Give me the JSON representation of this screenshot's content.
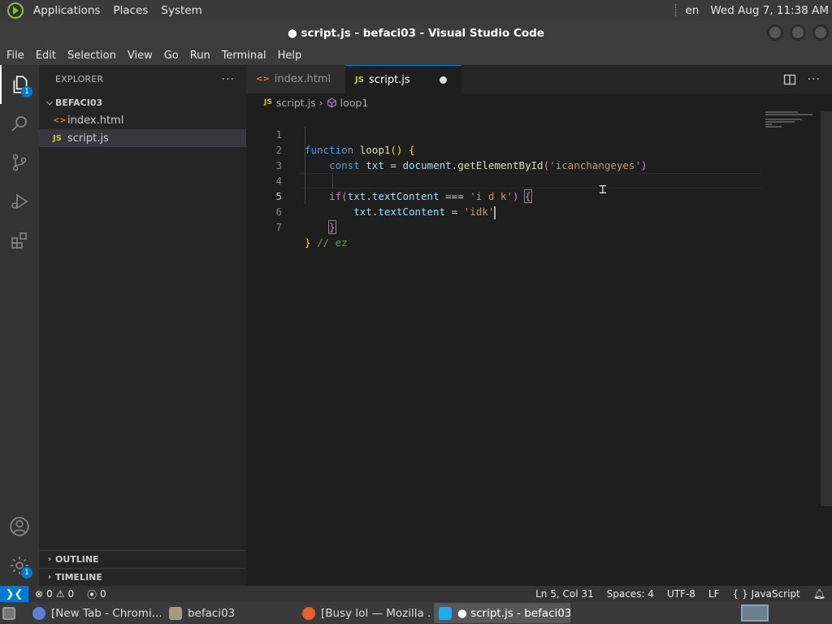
{
  "system_panel": {
    "menu": [
      "Applications",
      "Places",
      "System"
    ],
    "language": "en",
    "clock": "Wed Aug  7, 11:38 AM"
  },
  "window": {
    "title": "● script.js - befaci03 - Visual Studio Code"
  },
  "menubar": [
    "File",
    "Edit",
    "Selection",
    "View",
    "Go",
    "Run",
    "Terminal",
    "Help"
  ],
  "activity_bar": {
    "items": [
      {
        "icon": "files-icon",
        "badge": "1"
      },
      {
        "icon": "search-icon"
      },
      {
        "icon": "source-control-icon"
      },
      {
        "icon": "run-debug-icon"
      },
      {
        "icon": "extensions-icon"
      }
    ],
    "account_icon": "account-icon",
    "manage_icon": "gear-icon",
    "manage_badge": "1"
  },
  "explorer": {
    "title": "EXPLORER",
    "more": "···",
    "folder": "BEFACI03",
    "files": [
      {
        "name": "index.html",
        "icon": "<>"
      },
      {
        "name": "script.js",
        "icon": "JS"
      }
    ],
    "outline": "OUTLINE",
    "timeline": "TIMELINE"
  },
  "tabs": [
    {
      "label": "index.html",
      "icon": "<>"
    },
    {
      "label": "script.js",
      "icon": "JS"
    }
  ],
  "breadcrumb": {
    "file": "script.js",
    "file_icon": "JS",
    "symbol": "loop1"
  },
  "code": {
    "line_numbers": [
      "1",
      "2",
      "3",
      "4",
      "5",
      "6",
      "7"
    ]
  },
  "status": {
    "errors": "0",
    "warnings": "0",
    "ports": "0",
    "position": "Ln 5, Col 31",
    "spaces": "Spaces: 4",
    "encoding": "UTF-8",
    "eol": "LF",
    "language": "JavaScript",
    "lang_icon": "{ }"
  },
  "taskbar": [
    {
      "label": "[New Tab - Chromi...",
      "icon": "chromium-icon"
    },
    {
      "label": "befaci03",
      "icon": "folder-icon"
    },
    {
      "label": "[Busy lol — Mozilla ...",
      "icon": "firefox-icon"
    },
    {
      "label": "● script.js - befaci03...",
      "icon": "vscode-icon"
    }
  ],
  "colors": {
    "accent": "#007acc",
    "status_remote": "#0078d4"
  }
}
